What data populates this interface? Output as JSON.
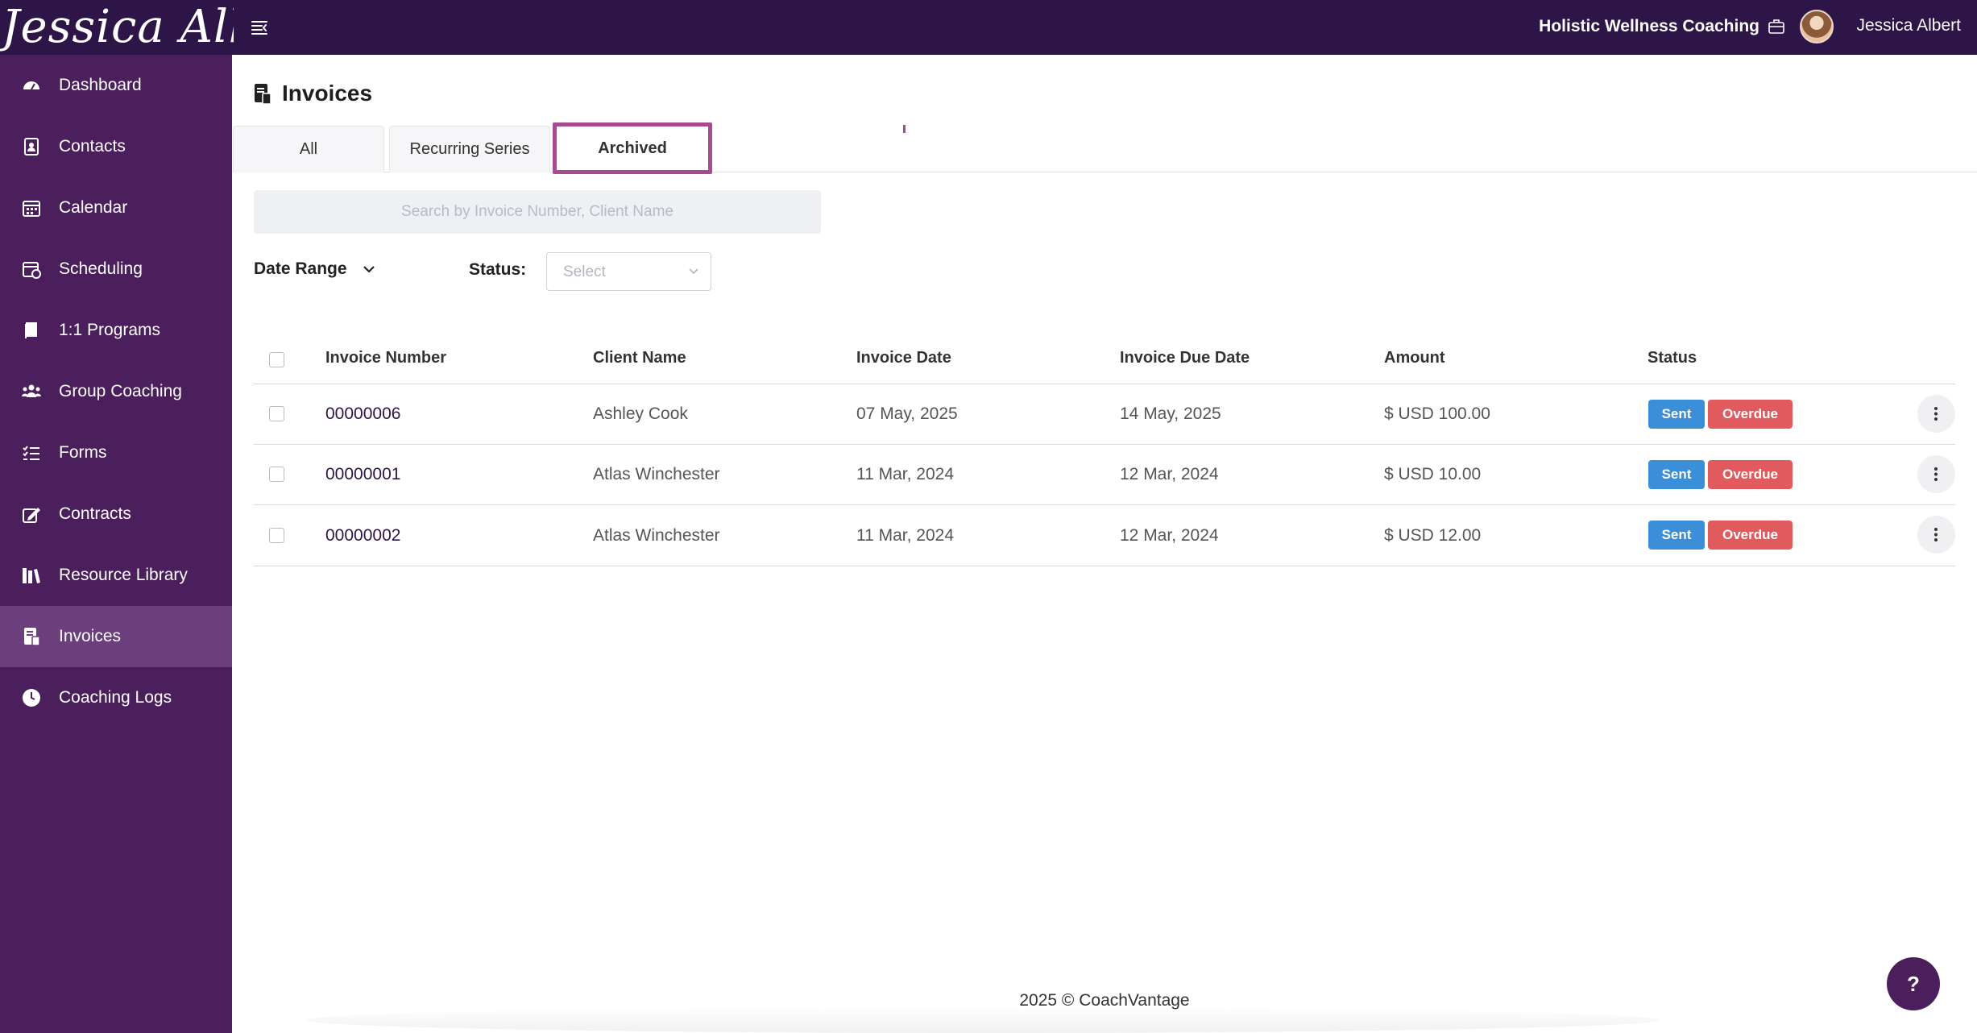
{
  "header": {
    "logo_text": "Jessica Albert",
    "org_name": "Holistic Wellness Coaching",
    "user_name": "Jessica Albert"
  },
  "sidebar": {
    "items": [
      {
        "label": "Dashboard",
        "icon": "dashboard-icon"
      },
      {
        "label": "Contacts",
        "icon": "contacts-icon"
      },
      {
        "label": "Calendar",
        "icon": "calendar-icon"
      },
      {
        "label": "Scheduling",
        "icon": "scheduling-icon"
      },
      {
        "label": "1:1 Programs",
        "icon": "book-icon"
      },
      {
        "label": "Group Coaching",
        "icon": "group-icon"
      },
      {
        "label": "Forms",
        "icon": "list-icon"
      },
      {
        "label": "Contracts",
        "icon": "contract-icon"
      },
      {
        "label": "Resource Library",
        "icon": "library-icon"
      },
      {
        "label": "Invoices",
        "icon": "invoice-icon",
        "active": true
      },
      {
        "label": "Coaching Logs",
        "icon": "clock-icon"
      }
    ]
  },
  "page": {
    "title": "Invoices",
    "tabs": [
      {
        "label": "All"
      },
      {
        "label": "Recurring Series"
      },
      {
        "label": "Archived",
        "active": true
      }
    ],
    "search_placeholder": "Search by Invoice Number, Client Name",
    "date_range_label": "Date Range",
    "status_label": "Status:",
    "status_placeholder": "Select"
  },
  "table": {
    "headers": [
      "Invoice Number",
      "Client Name",
      "Invoice Date",
      "Invoice Due Date",
      "Amount",
      "Status"
    ],
    "rows": [
      {
        "invoice_number": "00000006",
        "client": "Ashley Cook",
        "date": "07 May, 2025",
        "due": "14 May, 2025",
        "amount": "$ USD 100.00",
        "status1": "Sent",
        "status2": "Overdue"
      },
      {
        "invoice_number": "00000001",
        "client": "Atlas Winchester",
        "date": "11 Mar, 2024",
        "due": "12 Mar, 2024",
        "amount": "$ USD 10.00",
        "status1": "Sent",
        "status2": "Overdue"
      },
      {
        "invoice_number": "00000002",
        "client": "Atlas Winchester",
        "date": "11 Mar, 2024",
        "due": "12 Mar, 2024",
        "amount": "$ USD 12.00",
        "status1": "Sent",
        "status2": "Overdue"
      }
    ]
  },
  "footer": {
    "text": "2025 © CoachVantage"
  },
  "help": {
    "label": "?"
  },
  "colors": {
    "topbar": "#2d1547",
    "sidebar": "#4a1f5c",
    "sidebar_active": "#6a3f7b",
    "sent": "#3b8fd9",
    "overdue": "#e05a5e",
    "tab_highlight": "#a64b8f"
  }
}
